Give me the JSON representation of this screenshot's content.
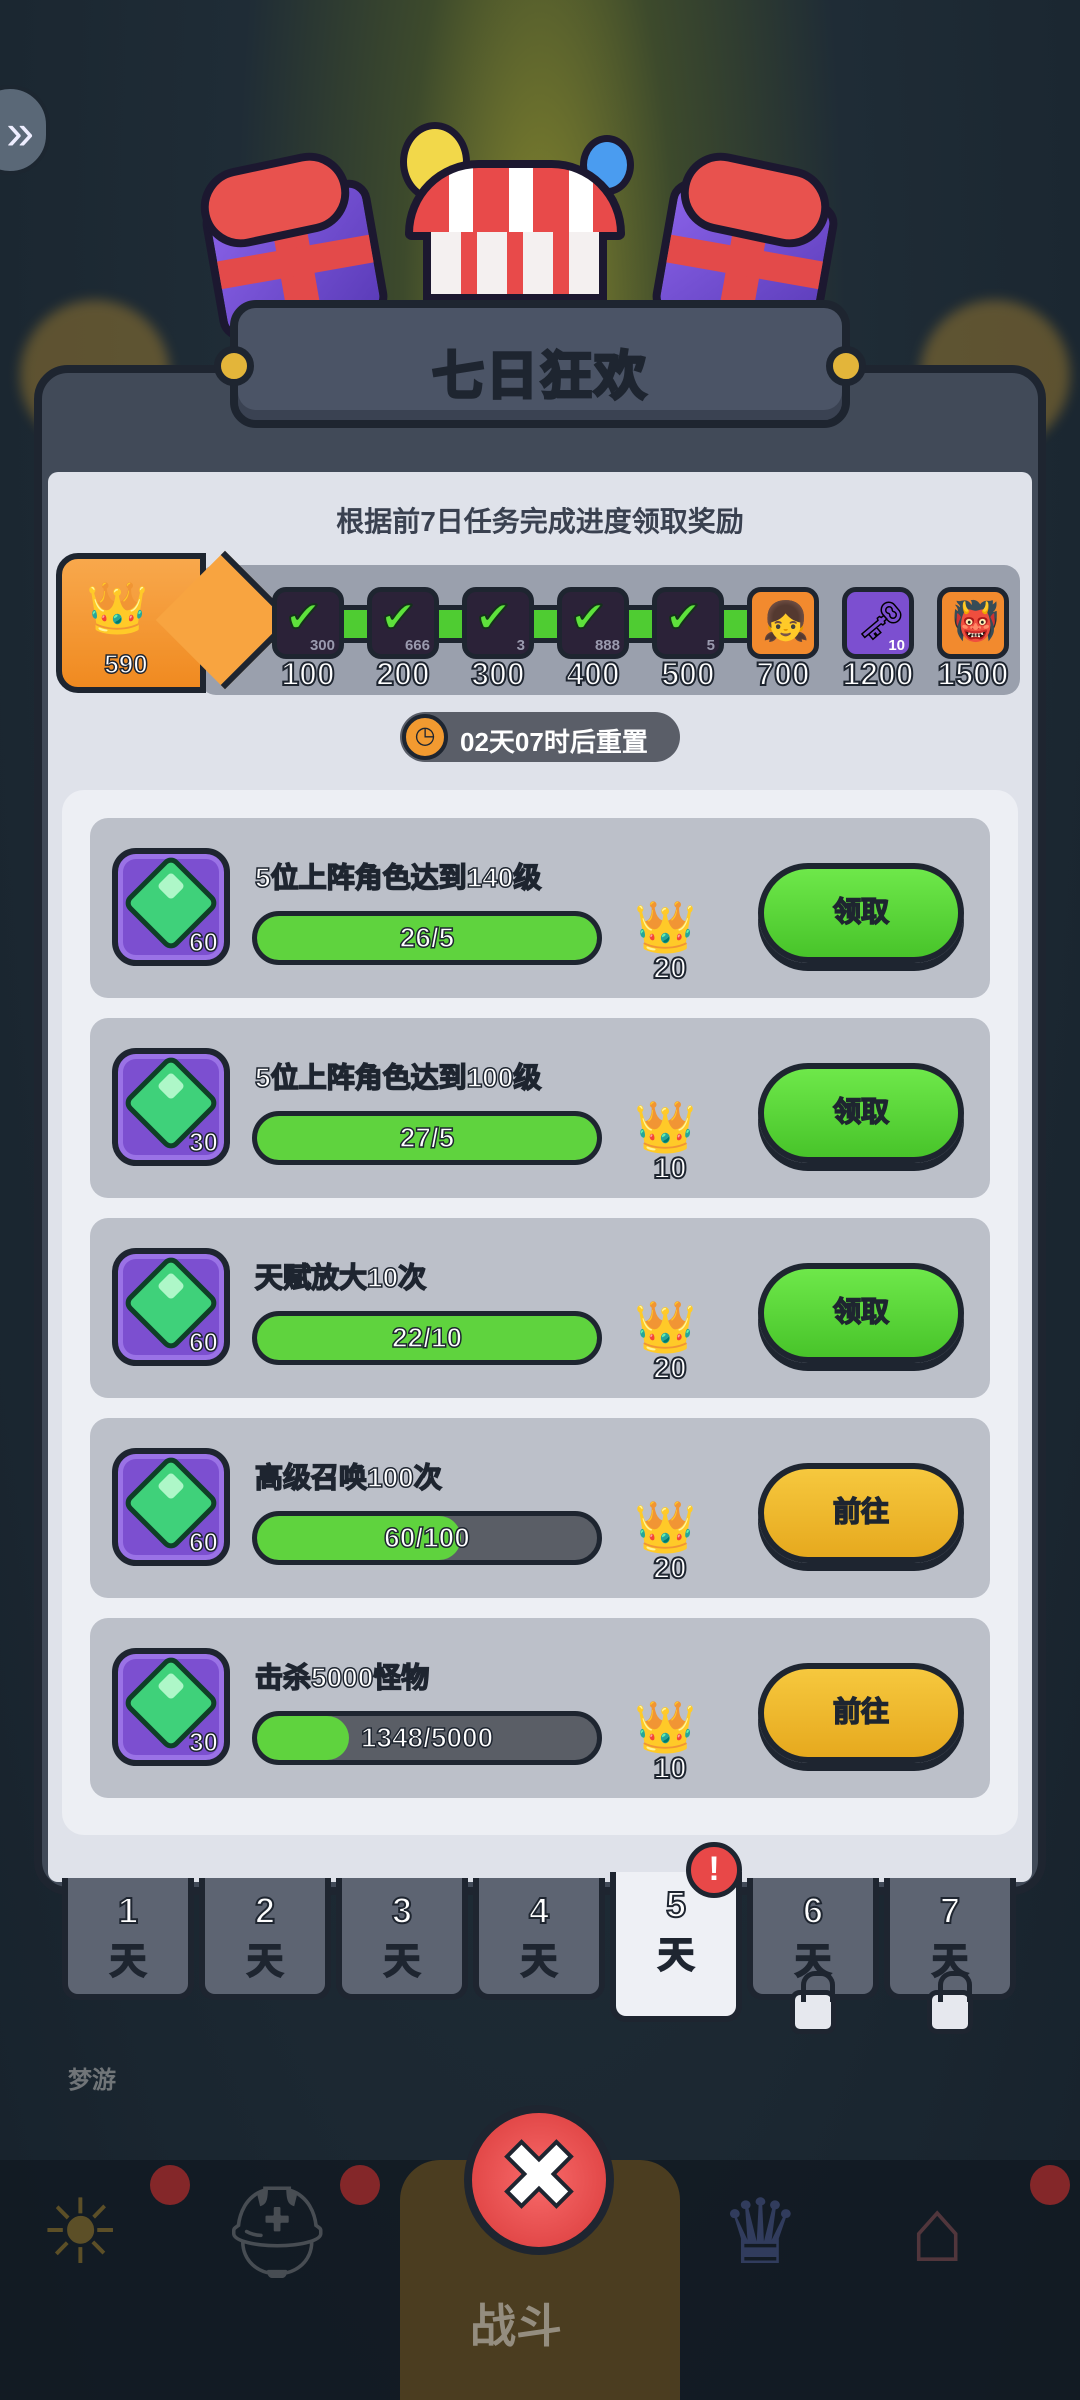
{
  "header": {
    "title": "七日狂欢"
  },
  "subtitle": "根据前7日任务完成进度领取奖励",
  "points_badge": {
    "value": "590",
    "icon": "crown-icon"
  },
  "milestones": [
    {
      "label": "100",
      "qty": "300",
      "claimed": true,
      "icon": "check-icon"
    },
    {
      "label": "200",
      "qty": "666",
      "claimed": true,
      "icon": "check-icon"
    },
    {
      "label": "300",
      "qty": "3",
      "claimed": true,
      "icon": "check-icon"
    },
    {
      "label": "400",
      "qty": "888",
      "claimed": true,
      "icon": "check-icon"
    },
    {
      "label": "500",
      "qty": "5",
      "claimed": true,
      "icon": "check-icon"
    },
    {
      "label": "700",
      "qty": "",
      "claimed": false,
      "icon": "hero-portrait-icon"
    },
    {
      "label": "1200",
      "qty": "10",
      "claimed": false,
      "icon": "key-icon"
    },
    {
      "label": "1500",
      "qty": "",
      "claimed": false,
      "icon": "hero-portrait-s-icon"
    }
  ],
  "timer": {
    "text": "02天07时后重置",
    "icon": "clock-icon"
  },
  "tasks": [
    {
      "title": "5位上阵角色达到140级",
      "gem_amount": "60",
      "progress_text": "26/5",
      "progress_fraction": 1.0,
      "points": "20",
      "action": "领取",
      "action_type": "claim"
    },
    {
      "title": "5位上阵角色达到100级",
      "gem_amount": "30",
      "progress_text": "27/5",
      "progress_fraction": 1.0,
      "points": "10",
      "action": "领取",
      "action_type": "claim"
    },
    {
      "title": "天赋放大10次",
      "gem_amount": "60",
      "progress_text": "22/10",
      "progress_fraction": 1.0,
      "points": "20",
      "action": "领取",
      "action_type": "claim"
    },
    {
      "title": "高级召唤100次",
      "gem_amount": "60",
      "progress_text": "60/100",
      "progress_fraction": 0.6,
      "points": "20",
      "action": "前往",
      "action_type": "goto"
    },
    {
      "title": "击杀5000怪物",
      "gem_amount": "30",
      "progress_text": "1348/5000",
      "progress_fraction": 0.27,
      "points": "10",
      "action": "前往",
      "action_type": "goto"
    }
  ],
  "day_tabs": [
    {
      "num": "1",
      "day": "天",
      "active": false,
      "locked": false
    },
    {
      "num": "2",
      "day": "天",
      "active": false,
      "locked": false
    },
    {
      "num": "3",
      "day": "天",
      "active": false,
      "locked": false
    },
    {
      "num": "4",
      "day": "天",
      "active": false,
      "locked": false
    },
    {
      "num": "5",
      "day": "天",
      "active": true,
      "locked": false,
      "alert": "!"
    },
    {
      "num": "6",
      "day": "天",
      "active": false,
      "locked": true
    },
    {
      "num": "7",
      "day": "天",
      "active": false,
      "locked": true
    }
  ],
  "bottom": {
    "battle_label": "战斗",
    "sleep_label": "梦游",
    "close_glyph": "✖"
  },
  "colors": {
    "claim_button": "#5fd33e",
    "goto_button": "#f0b62a",
    "progress_fill": "#5fd33e",
    "gem": "#3fd17a",
    "panel": "#414a58"
  }
}
